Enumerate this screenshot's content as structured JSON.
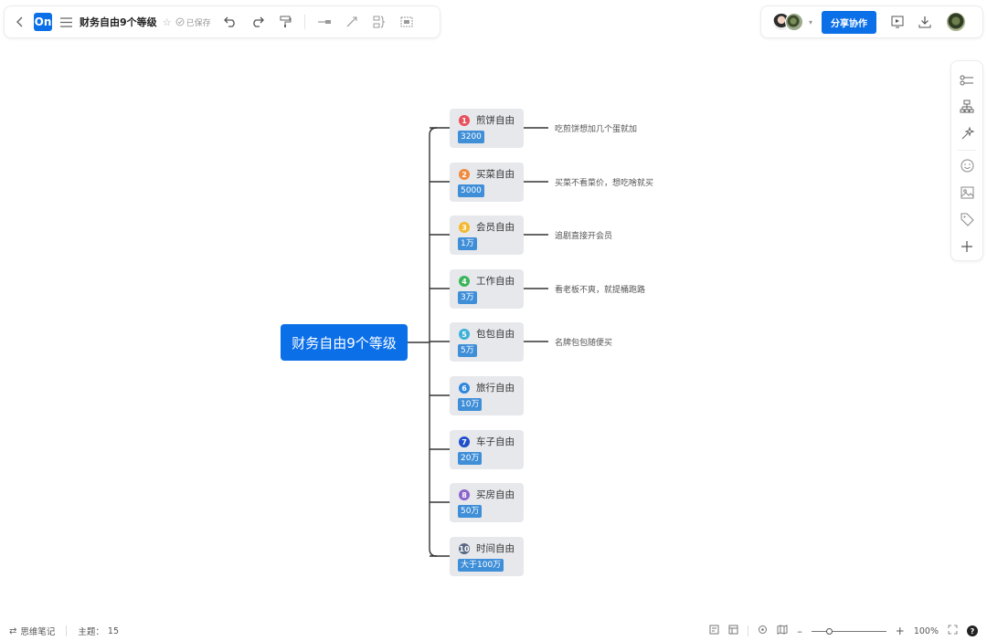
{
  "toolbar": {
    "logo_text": "On",
    "title": "财务自由9个等级",
    "saved_label": "已保存"
  },
  "header_right": {
    "share_label": "分享协作"
  },
  "mindmap": {
    "root": "财务自由9个等级",
    "topics": [
      {
        "index": "1",
        "label": "煎饼自由",
        "tag": "3200",
        "note": "吃煎饼想加几个蛋就加",
        "color": "#e8505b"
      },
      {
        "index": "2",
        "label": "买菜自由",
        "tag": "5000",
        "note": "买菜不看菜价，想吃啥就买",
        "color": "#f08a3e"
      },
      {
        "index": "3",
        "label": "会员自由",
        "tag": "1万",
        "note": "追剧直接开会员",
        "color": "#f5b82e"
      },
      {
        "index": "4",
        "label": "工作自由",
        "tag": "3万",
        "note": "看老板不爽，就提桶跑路",
        "color": "#3cb55a"
      },
      {
        "index": "5",
        "label": "包包自由",
        "tag": "5万",
        "note": "名牌包包随便买",
        "color": "#3cb0d9"
      },
      {
        "index": "6",
        "label": "旅行自由",
        "tag": "10万",
        "note": "",
        "color": "#2e86de"
      },
      {
        "index": "7",
        "label": "车子自由",
        "tag": "20万",
        "note": "",
        "color": "#1f4fc9"
      },
      {
        "index": "8",
        "label": "买房自由",
        "tag": "50万",
        "note": "",
        "color": "#8b63c9"
      },
      {
        "index": "10",
        "label": "时间自由",
        "tag": "大于100万",
        "note": "",
        "color": "#5a6a86"
      }
    ]
  },
  "footer": {
    "mode_label": "思维笔记",
    "topics_label": "主题：",
    "topics_count": "15",
    "zoom": "100%"
  }
}
